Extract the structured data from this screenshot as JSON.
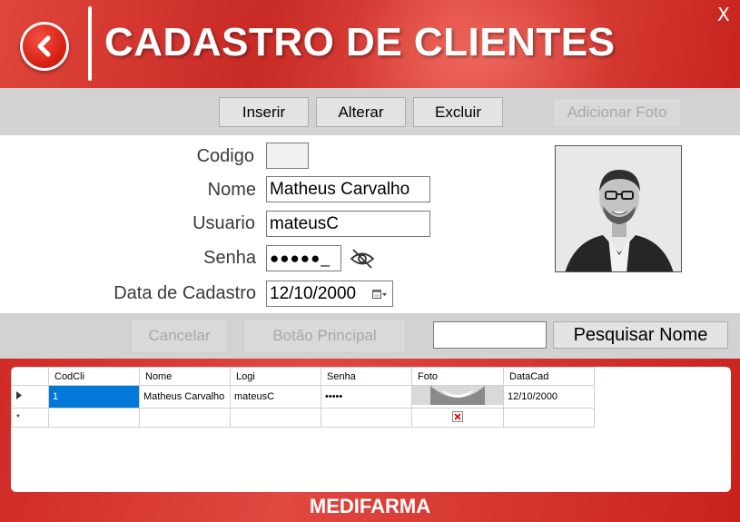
{
  "header": {
    "title": "CADASTRO DE CLIENTES",
    "close_label": "X"
  },
  "toolbar": {
    "insert_label": "Inserir",
    "edit_label": "Alterar",
    "delete_label": "Excluir",
    "add_photo_label": "Adicionar Foto"
  },
  "form": {
    "codigo_label": "Codigo",
    "codigo_value": "",
    "nome_label": "Nome",
    "nome_value": "Matheus Carvalho",
    "usuario_label": "Usuario",
    "usuario_value": "mateusC",
    "senha_label": "Senha",
    "senha_value": "●●●●●_",
    "data_label": "Data de Cadastro",
    "data_value": "12/10/2000"
  },
  "actions": {
    "cancel_label": "Cancelar",
    "main_button_label": "Botão Principal",
    "search_value": "",
    "search_button_label": "Pesquisar Nome"
  },
  "grid": {
    "columns": [
      "CodCli",
      "Nome",
      "Logi",
      "Senha",
      "Foto",
      "DataCad"
    ],
    "rows": [
      {
        "codcli": "1",
        "nome": "Matheus Carvalho",
        "logi": "mateusC",
        "senha": "•••••",
        "datacad": "12/10/2000"
      }
    ],
    "new_row_marker": "*"
  },
  "footer": {
    "brand": "MEDIFARMA"
  },
  "colors": {
    "accent_red": "#d62a26",
    "bar_gray": "#d2d2d2",
    "selection_blue": "#0078d7"
  },
  "icons": [
    "back-arrow-icon",
    "eye-slash-icon",
    "calendar-icon",
    "row-pointer-icon",
    "broken-image-icon"
  ]
}
